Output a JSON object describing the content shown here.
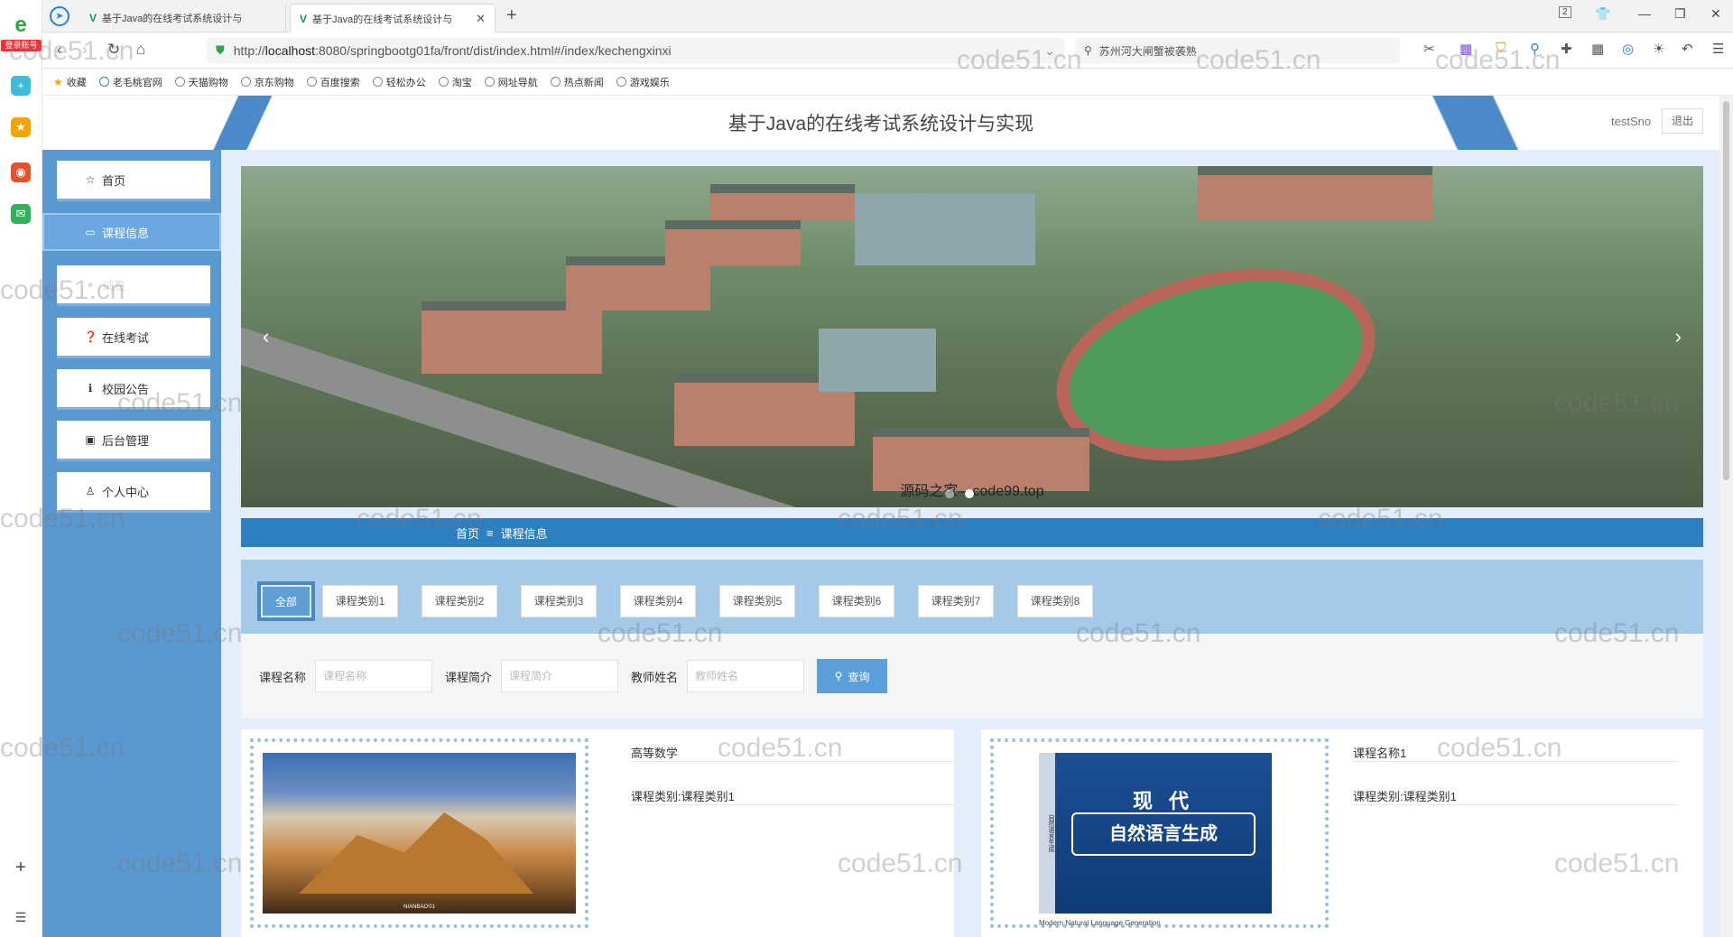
{
  "browser": {
    "tabs": [
      {
        "title": "基于Java的在线考试系统设计与",
        "active": false
      },
      {
        "title": "基于Java的在线考试系统设计与",
        "active": true
      }
    ],
    "page_indicator": "2",
    "url_scheme": "http://",
    "url_host": "localhost",
    "url_rest": ":8080/springbootg01fa/front/dist/index.html#/index/kechengxinxi",
    "search_text": "苏州河大闸蟹被袭熟",
    "rail_badge": "登录账号",
    "bookmarks": [
      "收藏",
      "老毛桃官网",
      "天猫购物",
      "京东购物",
      "百度搜索",
      "轻松办公",
      "淘宝",
      "网址导航",
      "热点新闻",
      "游戏娱乐"
    ]
  },
  "header": {
    "title": "基于Java的在线考试系统设计与实现",
    "username": "testSno",
    "logout_label": "退出"
  },
  "sidebar": {
    "items": [
      {
        "label": "首页",
        "icon": "star-icon"
      },
      {
        "label": "课程信息",
        "icon": "folder-icon",
        "active": true
      },
      {
        "label": "试卷",
        "icon": "paper-icon"
      },
      {
        "label": "在线考试",
        "icon": "question-circle-icon"
      },
      {
        "label": "校园公告",
        "icon": "info-circle-icon"
      },
      {
        "label": "后台管理",
        "icon": "briefcase-icon"
      },
      {
        "label": "个人中心",
        "icon": "user-icon"
      }
    ]
  },
  "banner": {
    "caption": "源码之家—code99.top",
    "prev": "‹",
    "next": "›"
  },
  "breadcrumb": {
    "home": "首页",
    "separator": "≡",
    "current": "课程信息"
  },
  "categories": [
    "全部",
    "课程类别1",
    "课程类别2",
    "课程类别3",
    "课程类别4",
    "课程类别5",
    "课程类别6",
    "课程类别7",
    "课程类别8"
  ],
  "search": {
    "fields": [
      {
        "label": "课程名称",
        "placeholder": "课程名称"
      },
      {
        "label": "课程简介",
        "placeholder": "课程简介"
      },
      {
        "label": "教师姓名",
        "placeholder": "教师姓名"
      }
    ],
    "button_label": "查询"
  },
  "courses": [
    {
      "name": "高等数学",
      "category": "课程类别:课程类别1",
      "image": "mountain",
      "image_label": "NIANBAO'01"
    },
    {
      "name": "课程名称1",
      "category": "课程类别:课程类别1",
      "image": "book",
      "book_title1": "现 代",
      "book_title2": "自然语言生成",
      "book_sub": "Modern Natural Language Generation"
    }
  ],
  "watermark": "code51.cn",
  "colors": {
    "sidebar": "#5a98d2",
    "breadcrumb": "#2e7fc0",
    "category_bar": "#a4c9e9",
    "accent": "#5a9fd9"
  }
}
